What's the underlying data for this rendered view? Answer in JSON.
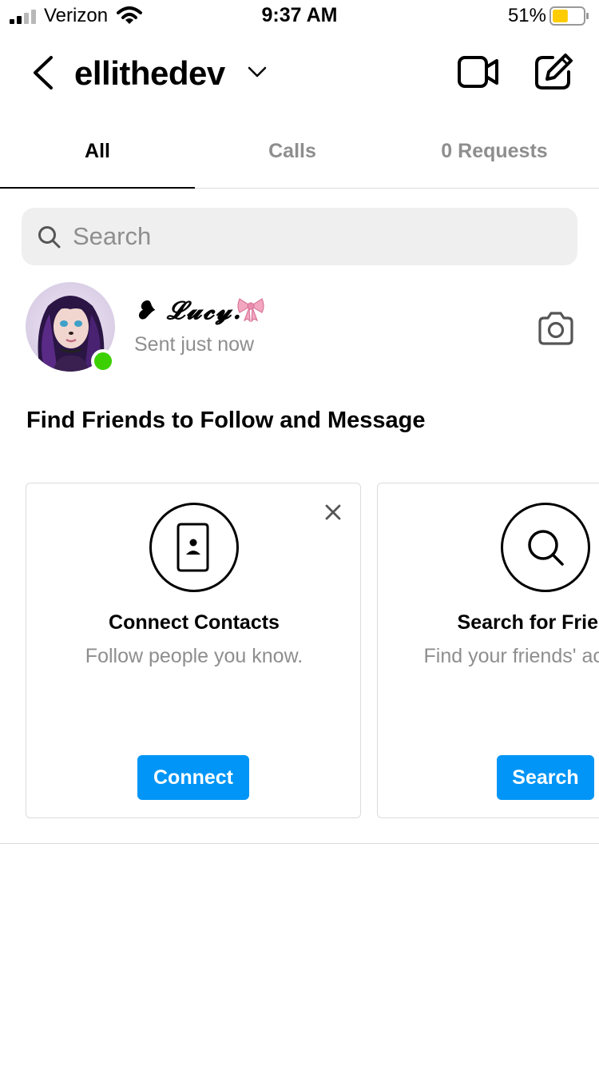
{
  "status_bar": {
    "carrier": "Verizon",
    "time": "9:37 AM",
    "battery_percent": "51%",
    "battery_level": 0.51,
    "battery_color": "#ffcc00",
    "icons": [
      "signal-icon",
      "wifi-icon",
      "battery-icon"
    ]
  },
  "header": {
    "username": "ellithedev",
    "icons": [
      "back-icon",
      "chevron-down-icon",
      "video-call-icon",
      "compose-icon"
    ]
  },
  "tabs": [
    {
      "label": "All",
      "active": true
    },
    {
      "label": "Calls",
      "active": false
    },
    {
      "label": "0 Requests",
      "active": false
    }
  ],
  "search": {
    "placeholder": "Search",
    "value": ""
  },
  "threads": [
    {
      "name_prefix": "❥",
      "name": "𝓛𝓾𝓬𝔂.",
      "emoji": "bow-icon",
      "meta": "Sent just now",
      "online": true,
      "action_icon": "camera-icon"
    }
  ],
  "find_friends": {
    "title": "Find Friends to Follow and Message",
    "cards": [
      {
        "icon": "contacts-icon",
        "title": "Connect Contacts",
        "subtitle": "Follow people you know.",
        "button": "Connect",
        "dismissible": true
      },
      {
        "icon": "search-icon",
        "title": "Search for Friends",
        "subtitle": "Find your friends' accounts.",
        "button": "Search",
        "dismissible": false
      }
    ]
  },
  "colors": {
    "accent": "#0095f6",
    "online": "#3cd000",
    "secondary_text": "#8e8e8e",
    "search_bg": "#efefef",
    "divider": "#dbdbdb"
  }
}
